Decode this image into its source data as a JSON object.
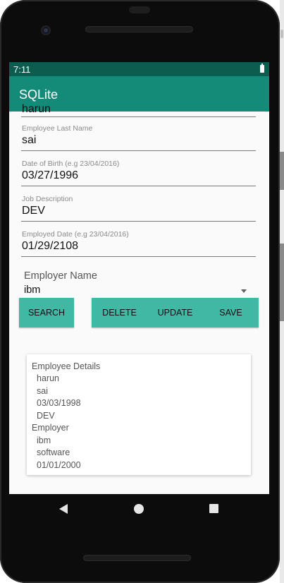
{
  "status_bar": {
    "time": "7:11"
  },
  "app_bar": {
    "title": "SQLite"
  },
  "form": {
    "first_name_value": "harun",
    "last_name": {
      "label": "Employee Last Name",
      "value": "sai"
    },
    "dob": {
      "label": "Date of Birth (e.g 23/04/2016)",
      "value": "03/27/1996"
    },
    "job": {
      "label": "Job Description",
      "value": "DEV"
    },
    "employed": {
      "label": "Employed Date (e.g 23/04/2016)",
      "value": "01/29/2108"
    },
    "employer": {
      "label": "Employer Name",
      "value": "ibm"
    }
  },
  "buttons": {
    "search": "SEARCH",
    "delete": "DELETE",
    "update": "UPDATE",
    "save": "SAVE"
  },
  "details": {
    "lines": [
      "Employee Details",
      "harun",
      "sai",
      "03/03/1998",
      "DEV",
      "Employer",
      "ibm",
      "software",
      "01/01/2000"
    ]
  },
  "colors": {
    "primary": "#148a78",
    "primary_dark": "#0c5c4f",
    "button": "#41b8a4"
  },
  "nav_icons": [
    "back-icon",
    "home-icon",
    "recents-icon"
  ]
}
